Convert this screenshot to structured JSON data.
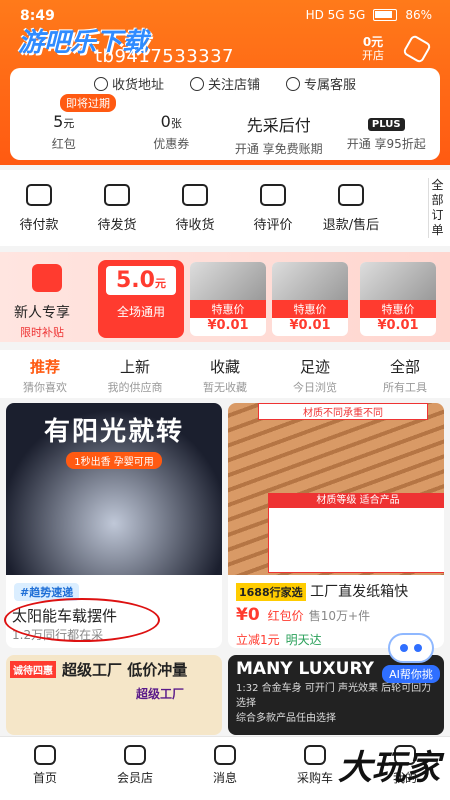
{
  "status": {
    "time": "8:49",
    "network": "HD 5G 5G",
    "battery": "86%"
  },
  "watermark_top": "游吧乐下载",
  "header": {
    "username": "tb9417533337",
    "shop_amount": "0元",
    "shop_label": "开店"
  },
  "links": [
    "收货地址",
    "关注店铺",
    "专属客服"
  ],
  "expire_badge": "即将过期",
  "stats": [
    {
      "value": "5",
      "unit": "元",
      "label": "红包"
    },
    {
      "value": "0",
      "unit": "张",
      "label": "优惠券"
    },
    {
      "value": "先采后付",
      "unit": "",
      "label": "开通 享免费账期"
    },
    {
      "value": "PLUS",
      "unit": "",
      "label": "开通 享95折起"
    }
  ],
  "orders": [
    "待付款",
    "待发货",
    "待收货",
    "待评价",
    "退款/售后"
  ],
  "all_orders": "全部订单",
  "promo": {
    "new_user": "新人专享",
    "new_user_sub": "限时补贴",
    "coupon_amount": "5.0",
    "coupon_unit": "元",
    "coupon_label": "全场通用",
    "deals": [
      {
        "tag": "特惠价",
        "price": "¥0.01"
      },
      {
        "tag": "特惠价",
        "price": "¥0.01"
      },
      {
        "tag": "特惠价",
        "price": "¥0.01"
      }
    ]
  },
  "tabs": [
    {
      "title": "推荐",
      "sub": "猜你喜欢"
    },
    {
      "title": "上新",
      "sub": "我的供应商"
    },
    {
      "title": "收藏",
      "sub": "暂无收藏"
    },
    {
      "title": "足迹",
      "sub": "今日浏览"
    },
    {
      "title": "全部",
      "sub": "所有工具"
    }
  ],
  "product1": {
    "headline": "有阳光就转",
    "slogan": "1秒出香 孕婴可用",
    "badge": "#趋势速递",
    "title": "太阳能车载摆件",
    "sub": "1.2万同行都在采"
  },
  "product2": {
    "img_label": "材质不同承重不同",
    "table_head": "材质等级 适合产品",
    "badge": "1688行家选",
    "title": "工厂直发纸箱快",
    "price": "¥0",
    "price_note": "红包价",
    "sales": "售10万+件",
    "discount": "立减1元",
    "delivery": "明天达"
  },
  "product3": {
    "tag": "诚待四惠",
    "title": "超级工厂 低价冲量",
    "brand": "超级工厂"
  },
  "product4": {
    "title": "MANY LUXURY",
    "sub1": "1:32 合金车身 可开门 声光效果 后轮可回力 选择",
    "sub2": "综合多款产品任由选择"
  },
  "ai_button": "AI帮你挑",
  "nav": [
    "首页",
    "会员店",
    "消息",
    "采购车",
    "我的"
  ],
  "watermark_bottom": "大玩家"
}
